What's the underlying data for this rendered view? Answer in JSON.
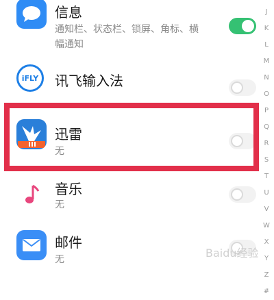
{
  "apps": [
    {
      "name": "信息",
      "subtitle_line1": "通知栏、状态栏、锁屏、角标、横",
      "subtitle_line2": "幅通知",
      "toggle": "on",
      "icon": "message-bubble-icon",
      "color": "#2f8cf5"
    },
    {
      "name": "讯飞输入法",
      "toggle": "off",
      "icon_text": "iFLY",
      "icon": "ifly-logo-icon",
      "color": "#1d7fe6"
    },
    {
      "name": "迅雷",
      "subtitle": "无",
      "toggle": "off",
      "icon": "thunder-bird-icon",
      "color": "#2a7fd9"
    },
    {
      "name": "音乐",
      "subtitle": "无",
      "toggle": "off",
      "icon": "music-note-icon",
      "color": "#e8467d"
    },
    {
      "name": "邮件",
      "subtitle": "无",
      "toggle": "off",
      "icon": "mail-envelope-icon",
      "color": "#3a8ef6"
    }
  ],
  "alphabet_index": [
    "J",
    "K",
    "L",
    "M",
    "N",
    "O",
    "P",
    "Q",
    "R",
    "S",
    "T",
    "U",
    "V",
    "W",
    "X",
    "Y",
    "Z",
    "#"
  ],
  "highlight_color": "#e22f4a",
  "watermark": "Baidu经验"
}
